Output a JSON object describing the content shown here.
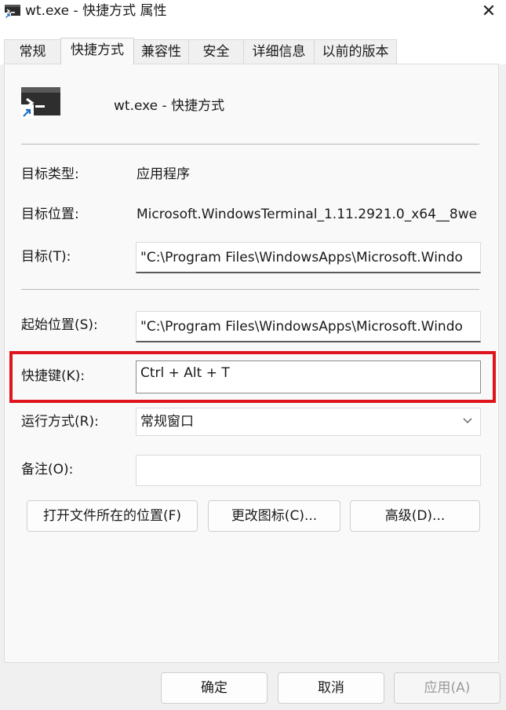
{
  "window": {
    "title": "wt.exe - 快捷方式 属性",
    "close_glyph": "✕"
  },
  "tabs": [
    {
      "label": "常规"
    },
    {
      "label": "快捷方式"
    },
    {
      "label": "兼容性"
    },
    {
      "label": "安全"
    },
    {
      "label": "详细信息"
    },
    {
      "label": "以前的版本"
    }
  ],
  "active_tab": "快捷方式",
  "header": {
    "name": "wt.exe - 快捷方式",
    "icon": "terminal-shortcut-icon"
  },
  "fields": {
    "target_type": {
      "label": "目标类型:",
      "value": "应用程序"
    },
    "target_location": {
      "label": "目标位置:",
      "value": "Microsoft.WindowsTerminal_1.11.2921.0_x64__8we"
    },
    "target": {
      "label": "目标(T):",
      "value": "\"C:\\Program Files\\WindowsApps\\Microsoft.Windo"
    },
    "start_in": {
      "label": "起始位置(S):",
      "value": "\"C:\\Program Files\\WindowsApps\\Microsoft.Windo"
    },
    "shortcut_key": {
      "label": "快捷键(K):",
      "value": "Ctrl + Alt + T"
    },
    "run": {
      "label": "运行方式(R):",
      "value": "常规窗口"
    },
    "comment": {
      "label": "备注(O):",
      "value": ""
    }
  },
  "buttons": {
    "open_location": "打开文件所在的位置(F)",
    "change_icon": "更改图标(C)...",
    "advanced": "高级(D)..."
  },
  "footer": {
    "ok": "确定",
    "cancel": "取消",
    "apply": "应用(A)"
  },
  "colors": {
    "highlight": "#e0141c",
    "panel": "#f9f9f9",
    "background": "#f0f0f0"
  }
}
